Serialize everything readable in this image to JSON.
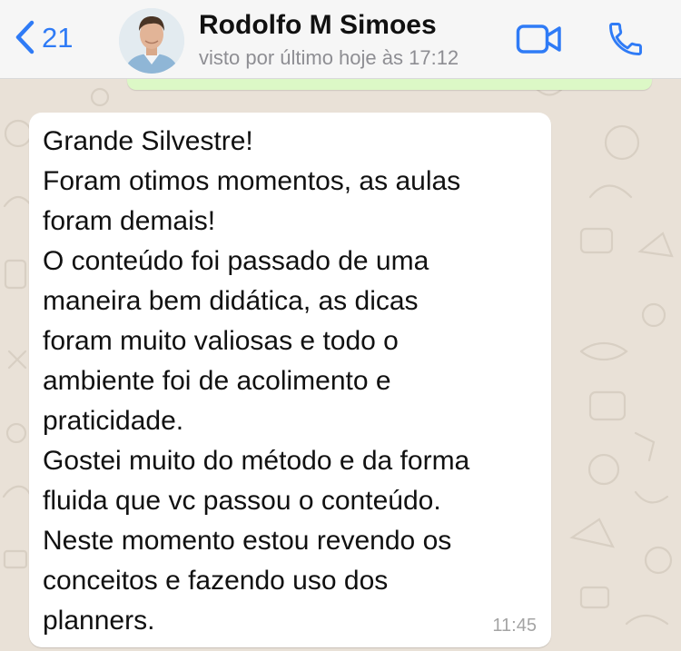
{
  "header": {
    "back_count": "21",
    "contact_name": "Rodolfo M Simoes",
    "last_seen": "visto por último hoje às 17:12",
    "accent_color": "#2f7bf6"
  },
  "icons": {
    "back": "chevron-left-icon",
    "video": "video-camera-icon",
    "call": "phone-icon"
  },
  "message": {
    "text": "Grande Silvestre!\nForam otimos momentos, as aulas\nforam demais!\nO conteúdo foi passado de uma\nmaneira bem didática, as dicas\nforam muito valiosas e todo o\nambiente foi de acolimento e\npraticidade.\nGostei muito do método e da forma\nfluida que vc passou o conteúdo.\nNeste momento estou revendo os\nconceitos e fazendo uso dos\nplanners.",
    "time": "11:45"
  }
}
